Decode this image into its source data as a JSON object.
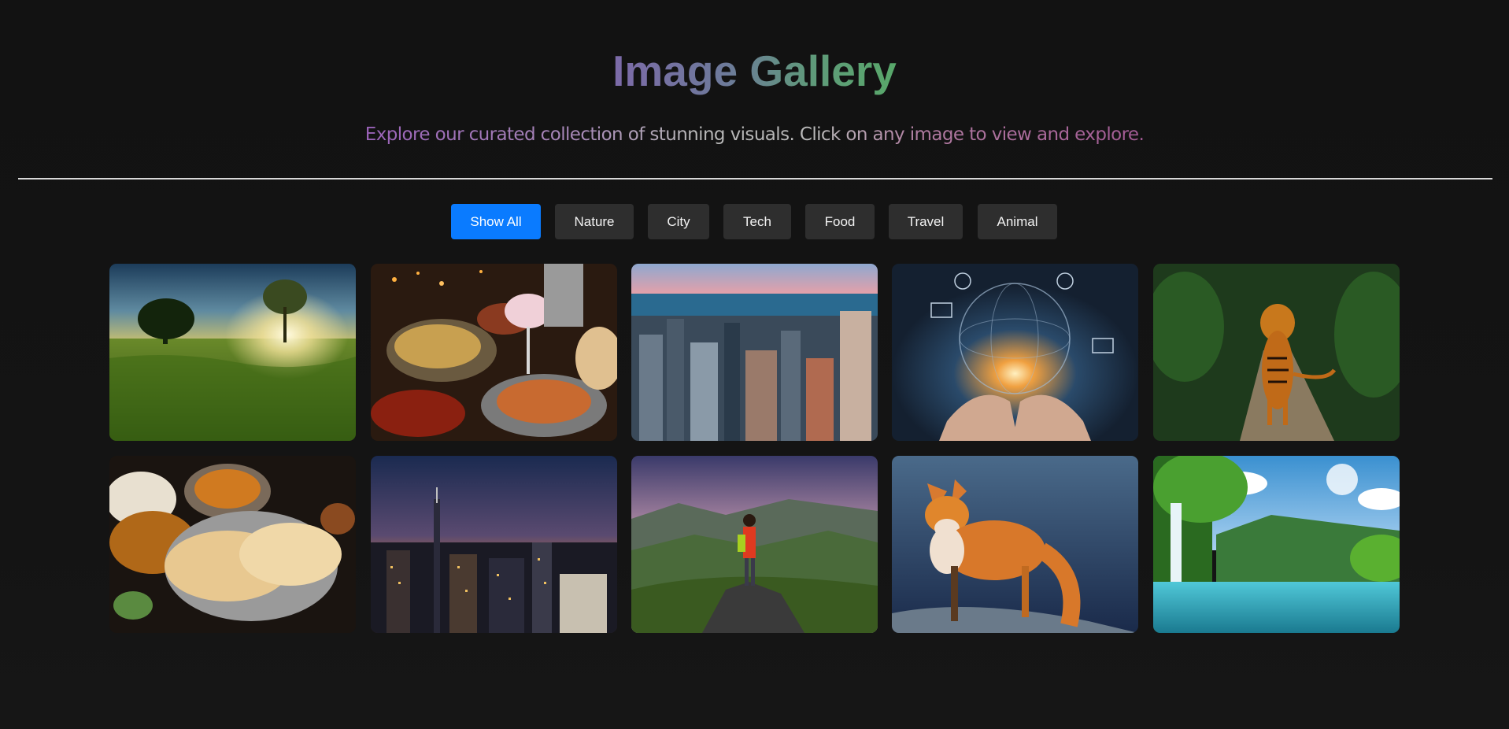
{
  "header": {
    "title": "Image Gallery",
    "subtitle": "Explore our curated collection of stunning visuals. Click on any image to view and explore."
  },
  "filters": [
    {
      "label": "Show All",
      "active": true
    },
    {
      "label": "Nature",
      "active": false
    },
    {
      "label": "City",
      "active": false
    },
    {
      "label": "Tech",
      "active": false
    },
    {
      "label": "Food",
      "active": false
    },
    {
      "label": "Travel",
      "active": false
    },
    {
      "label": "Animal",
      "active": false
    }
  ],
  "gallery": {
    "items": [
      {
        "category": "Nature",
        "subject": "tree-meadow-sunset"
      },
      {
        "category": "Food",
        "subject": "feast-table-drinks"
      },
      {
        "category": "City",
        "subject": "skyline-aerial-day"
      },
      {
        "category": "Tech",
        "subject": "globe-in-hands"
      },
      {
        "category": "Animal",
        "subject": "tiger-jungle-path"
      },
      {
        "category": "Food",
        "subject": "curry-naan-platter"
      },
      {
        "category": "City",
        "subject": "skyline-night-sunset"
      },
      {
        "category": "Travel",
        "subject": "hiker-mountain-view"
      },
      {
        "category": "Animal",
        "subject": "red-fox"
      },
      {
        "category": "Nature",
        "subject": "waterfall-lagoon"
      }
    ]
  },
  "colors": {
    "background": "#121212",
    "active_filter": "#0a7bff",
    "filter_button": "#2e2e2e",
    "divider": "#d8d8d8"
  }
}
